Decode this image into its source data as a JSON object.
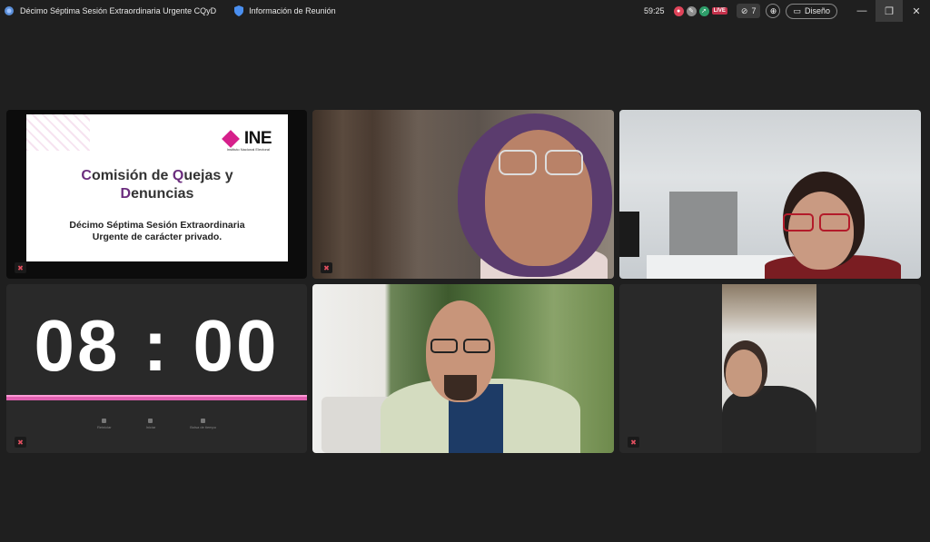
{
  "titlebar": {
    "meeting_title": "Décimo Séptima Sesión Extraordinaria Urgente CQyD",
    "meeting_info": "Información de Reunión",
    "elapsed": "59:25",
    "live_label": "LIVE",
    "participants_count": "7",
    "design_label": "Diseño",
    "icons": [
      "teams-icon",
      "shield-icon",
      "record-icon",
      "pen-icon",
      "share-icon",
      "eye-off-icon",
      "zoom-icon",
      "layout-icon"
    ]
  },
  "slide": {
    "logo_word": "INE",
    "logo_sub": "Instituto Nacional Electoral",
    "title_line1_c": "C",
    "title_line1_rest": "omisión de ",
    "title_line1_q": "Q",
    "title_line1_end": "uejas y",
    "title_line2_d": "D",
    "title_line2_end": "enuncias",
    "subtitle_line1": "Décimo Séptima Sesión Extraordinaria",
    "subtitle_line2": "Urgente de carácter privado."
  },
  "clock": {
    "time": "08 : 00",
    "controls": [
      "Reiniciar",
      "Iniciar",
      "Bolsa de tiempo"
    ]
  },
  "colors": {
    "background": "#1f1f1f",
    "tile": "#292929",
    "ine_magenta": "#d6208b",
    "clock_bar": "#e060b0",
    "muted_red": "#e04f5f"
  }
}
